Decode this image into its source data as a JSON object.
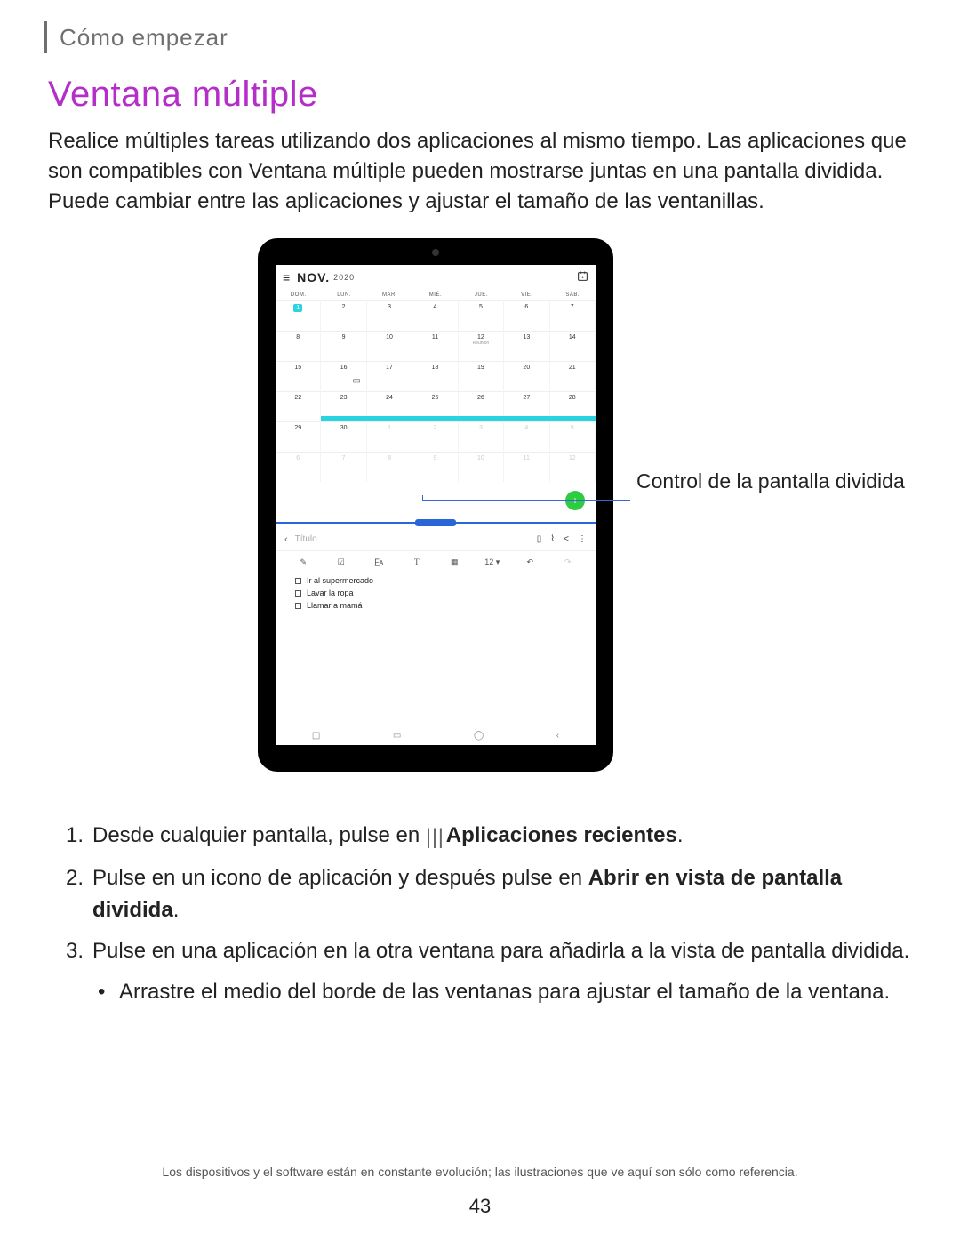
{
  "crumb": "Cómo empezar",
  "title": "Ventana múltiple",
  "intro": "Realice múltiples tareas utilizando dos aplicaciones al mismo tiempo. Las aplicaciones que son compatibles con Ventana múltiple pueden mostrarse juntas en una pantalla dividida. Puede cambiar entre las aplicaciones y ajustar el tamaño de las ventanillas.",
  "callout": "Control de la pantalla dividida",
  "tablet": {
    "calendar": {
      "month": "NOV.",
      "year": "2020",
      "dow": [
        "DOM.",
        "LUN.",
        "MAR.",
        "MIÉ.",
        "JUE.",
        "VIE.",
        "SÁB."
      ],
      "event_sub": "Reunión"
    },
    "notes": {
      "title_placeholder": "Título",
      "font_size": "12",
      "items": [
        "Ir al supermercado",
        "Lavar la ropa",
        "Llamar a mamá"
      ]
    }
  },
  "steps": {
    "s1a": "Desde cualquier pantalla, pulse en ",
    "s1b": " Aplicaciones recientes",
    "s2a": "Pulse en un icono de aplicación y después pulse en ",
    "s2b": "Abrir en vista de pantalla dividida",
    "s3": "Pulse en una aplicación en la otra ventana para añadirla a la vista de pantalla dividida.",
    "s3sub": "Arrastre el medio del borde de las ventanas para ajustar el tamaño de la ventana."
  },
  "footer": "Los dispositivos y el software están en constante evolución; las ilustraciones que ve aquí son sólo como referencia.",
  "page_number": "43"
}
